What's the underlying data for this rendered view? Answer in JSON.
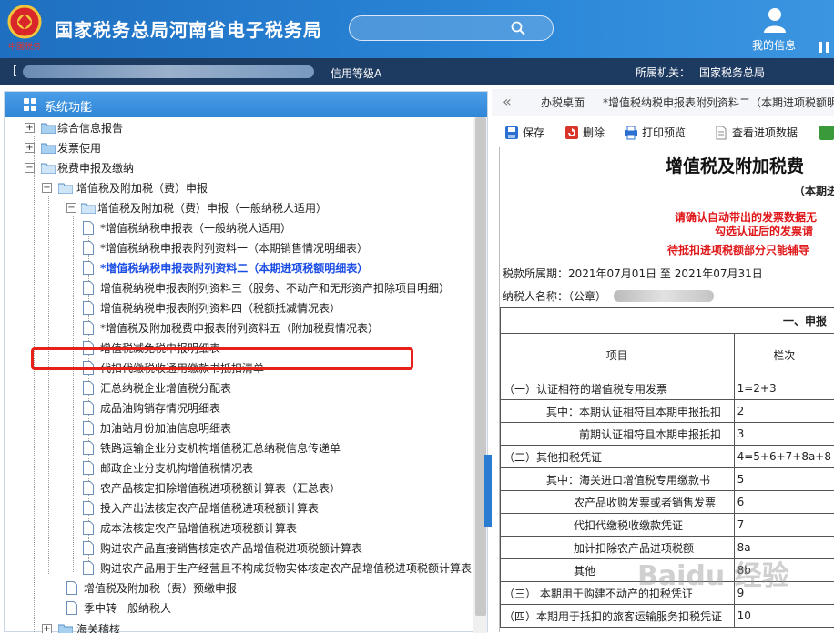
{
  "header": {
    "title": "国家税务总局河南省电子税务局",
    "logo_text": "中国税务",
    "search_placeholder": "",
    "user_label": "我的信息"
  },
  "infobar": {
    "bracket": "[",
    "credit": "信用等级A",
    "org_label": "所属机关：",
    "org_value": "国家税务总局"
  },
  "left": {
    "title": "系统功能",
    "tree": [
      {
        "label": "综合信息报告"
      },
      {
        "label": "发票使用"
      },
      {
        "label": "税费申报及缴纳"
      },
      {
        "label": "增值税及附加税（费）申报"
      },
      {
        "label": "增值税及附加税（费）申报（一般纳税人适用）"
      },
      {
        "label": "*增值税纳税申报表（一般纳税人适用）"
      },
      {
        "label": "*增值税纳税申报表附列资料一（本期销售情况明细表）"
      },
      {
        "label": "*增值税纳税申报表附列资料二（本期进项税额明细表）"
      },
      {
        "label": "增值税纳税申报表附列资料三（服务、不动产和无形资产扣除项目明细）"
      },
      {
        "label": "增值税纳税申报表附列资料四（税额抵减情况表）"
      },
      {
        "label": "*增值税及附加税费申报表附列资料五（附加税费情况表）"
      },
      {
        "label": "增值税减免税申报明细表"
      },
      {
        "label": "代扣代缴税收通用缴款书抵扣清单"
      },
      {
        "label": "汇总纳税企业增值税分配表"
      },
      {
        "label": "成品油购销存情况明细表"
      },
      {
        "label": "加油站月份加油信息明细表"
      },
      {
        "label": "铁路运输企业分支机构增值税汇总纳税信息传递单"
      },
      {
        "label": "邮政企业分支机构增值税情况表"
      },
      {
        "label": "农产品核定扣除增值税进项税额计算表（汇总表）"
      },
      {
        "label": "投入产出法核定农产品增值税进项税额计算表"
      },
      {
        "label": "成本法核定农产品增值税进项税额计算表"
      },
      {
        "label": "购进农产品直接销售核定农产品增值税进项税额计算表"
      },
      {
        "label": "购进农产品用于生产经营且不构成货物实体核定农产品增值税进项税额计算表"
      },
      {
        "label": "增值税及附加税（费）预缴申报"
      },
      {
        "label": "季中转一般纳税人"
      },
      {
        "label": "海关稽核"
      }
    ]
  },
  "right": {
    "tab_arrow": "«",
    "tabs": [
      {
        "label": "办税桌面"
      },
      {
        "label": "*增值税纳税申报表附列资料二（本期进项税额明"
      }
    ],
    "toolbar": [
      {
        "label": "保存",
        "color": "#2a6fd1"
      },
      {
        "label": "删除",
        "color": "#d9362b"
      },
      {
        "label": "打印预览",
        "color": "#2a6fd1"
      },
      {
        "label": "查看进项数据",
        "color": "#888888"
      }
    ],
    "form": {
      "title": "增值税及附加税费",
      "subtitle": "（本期进",
      "notice1": "请确认自动带出的发票数据无",
      "notice2": "勾选认证后的发票请",
      "notice3": "待抵扣进项税额部分只能辅导",
      "period": "税款所属期：2021年07月01日 至 2021年07月31日",
      "taxpayer": "纳税人名称：（公章）",
      "section": "一、申报",
      "col_item": "项目",
      "col_no": "栏次",
      "rows": [
        {
          "item": "（一）认证相符的增值税专用发票",
          "no": "1=2+3",
          "indent": 0
        },
        {
          "item": "其中：本期认证相符且本期申报抵扣",
          "no": "2",
          "indent": 1
        },
        {
          "item": "前期认证相符且本期申报抵扣",
          "no": "3",
          "indent": 2
        },
        {
          "item": "（二）其他扣税凭证",
          "no": "4=5+6+7+8a+8",
          "indent": 0
        },
        {
          "item": "其中：海关进口增值税专用缴款书",
          "no": "5",
          "indent": 1
        },
        {
          "item": "农产品收购发票或者销售发票",
          "no": "6",
          "indent": 2
        },
        {
          "item": "代扣代缴税收缴款凭证",
          "no": "7",
          "indent": 2
        },
        {
          "item": "加计扣除农产品进项税额",
          "no": "8a",
          "indent": 2
        },
        {
          "item": "其他",
          "no": "8b",
          "indent": 2
        },
        {
          "item": "（三） 本期用于购建不动产的扣税凭证",
          "no": "9",
          "indent": 0
        },
        {
          "item": "（四）本期用于抵扣的旅客运输服务扣税凭证",
          "no": "10",
          "indent": 0
        }
      ]
    }
  },
  "watermark": "Baidu 经验"
}
